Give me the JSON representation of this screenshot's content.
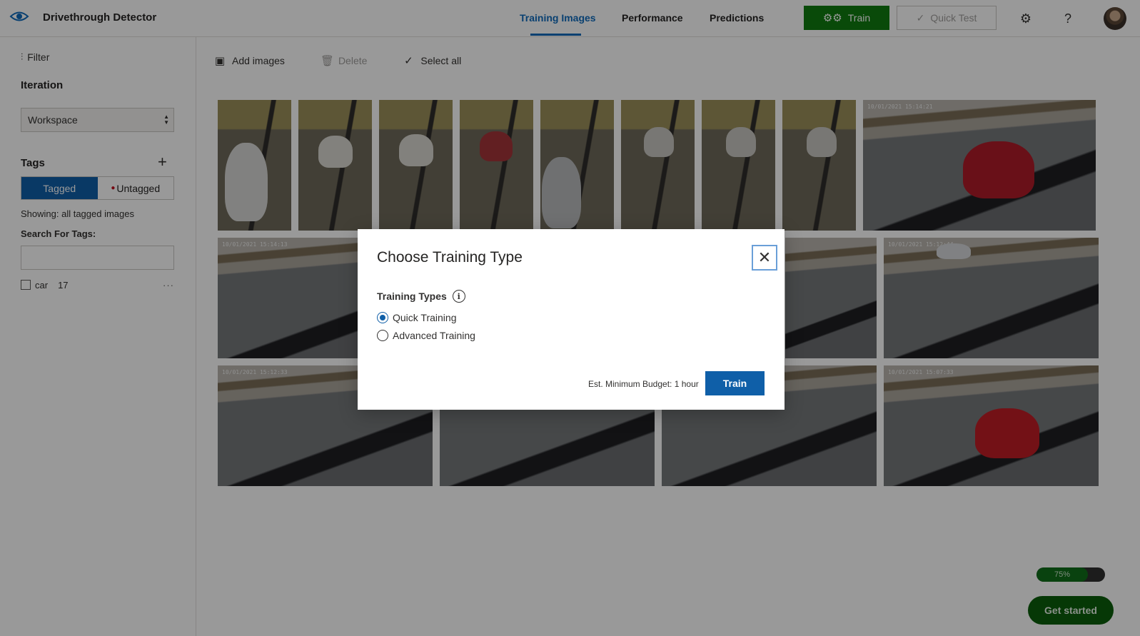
{
  "app": {
    "title": "Drivethrough Detector",
    "brand_icon": "eye-icon"
  },
  "nav": {
    "tabs": [
      {
        "label": "Training Images",
        "active": true
      },
      {
        "label": "Performance",
        "active": false
      },
      {
        "label": "Predictions",
        "active": false
      }
    ]
  },
  "header": {
    "train_label": "Train",
    "quick_test_label": "Quick Test",
    "settings_icon": "gear-icon",
    "help_label": "?"
  },
  "sidebar": {
    "filter_label": "Filter",
    "iteration_heading": "Iteration",
    "iteration_value": "Workspace",
    "tags_heading": "Tags",
    "toggle": {
      "tagged": "Tagged",
      "untagged": "Untagged"
    },
    "showing_text": "Showing: all tagged images",
    "search_label": "Search For Tags:",
    "search_value": "",
    "tags": [
      {
        "name": "car",
        "count": "17"
      }
    ]
  },
  "toolbar": {
    "add_images": "Add images",
    "delete": "Delete",
    "select_all": "Select all"
  },
  "images": {
    "timestamps": [
      "10/01/2021 15:14:21",
      "10/01/2021 15:14:13",
      "10/01/2021 15:12:44",
      "10/01/2021 15:12:33",
      "10/01/2021 15:07:33"
    ]
  },
  "dialog": {
    "title": "Choose Training Type",
    "types_label": "Training Types",
    "options": [
      {
        "label": "Quick Training",
        "checked": true
      },
      {
        "label": "Advanced Training",
        "checked": false
      }
    ],
    "budget_text": "Est. Minimum Budget: 1 hour",
    "train_label": "Train"
  },
  "progress": {
    "value": 0.75,
    "label": "75%"
  },
  "get_started_label": "Get started",
  "colors": {
    "accent": "#0f6cbd",
    "train_green": "#107c10",
    "primary_blue": "#0f5fa8"
  }
}
